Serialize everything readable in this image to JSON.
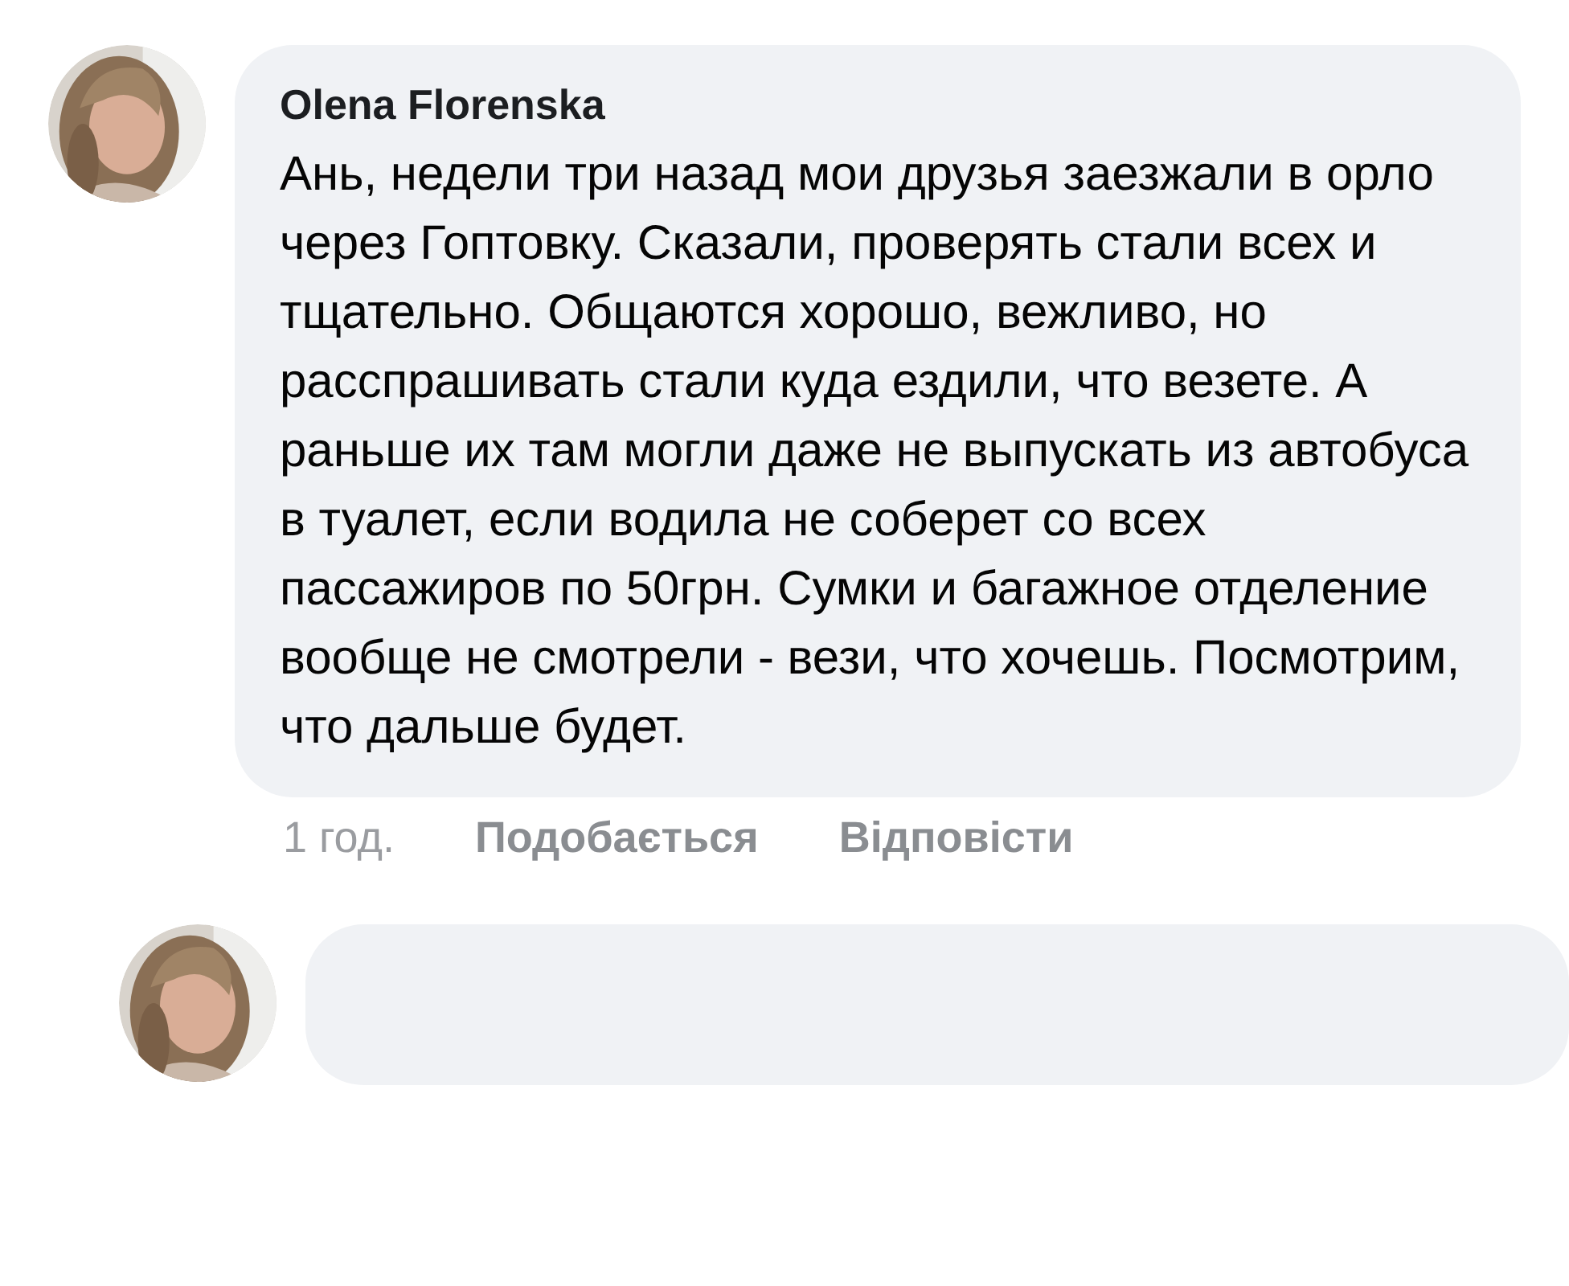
{
  "comment": {
    "author": "Olena Florenska",
    "text": "Ань, недели три назад мои друзья заезжали в орло через Гоптовку. Сказали, проверять стали всех и тщательно. Общаются хорошо, вежливо, но расспрашивать стали куда ездили, что везете. А раньше их там могли даже не выпускать из автобуса в туалет, если водила не соберет со всех пассажиров по 50грн. Сумки и багажное отделение вообще не смотрели - вези, что хочешь. Посмотрим, что дальше будет.",
    "time": "1 год.",
    "actions": [
      "Подобається",
      "Відповісти"
    ]
  }
}
